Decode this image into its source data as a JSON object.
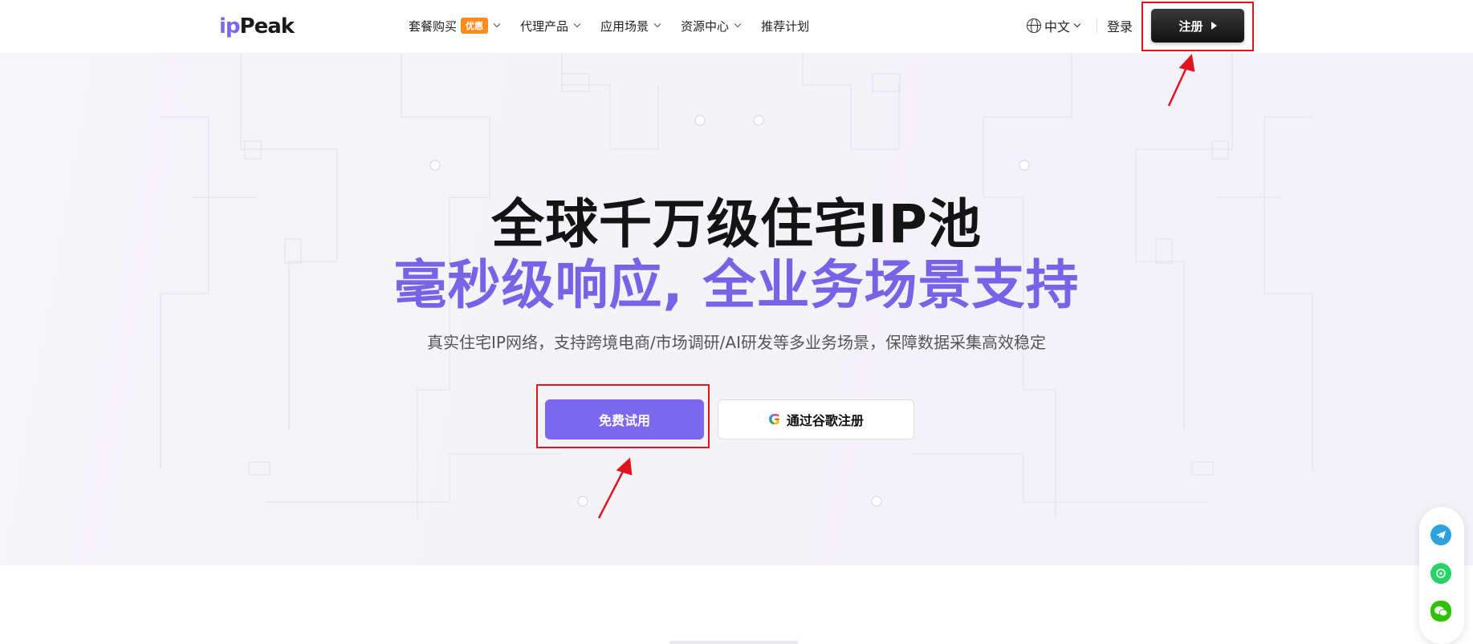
{
  "header": {
    "logo_ip": "ip",
    "logo_peak": "Peak",
    "nav": [
      {
        "label": "套餐购买",
        "badge": "优惠",
        "has_dropdown": true
      },
      {
        "label": "代理产品",
        "has_dropdown": true
      },
      {
        "label": "应用场景",
        "has_dropdown": true
      },
      {
        "label": "资源中心",
        "has_dropdown": true
      },
      {
        "label": "推荐计划",
        "has_dropdown": false
      }
    ],
    "language": "中文",
    "login": "登录",
    "register": "注册"
  },
  "hero": {
    "title_line1": "全球千万级住宅IP池",
    "title_line2": "毫秒级响应, 全业务场景支持",
    "subtitle": "真实住宅IP网络，支持跨境电商/市场调研/AI研发等多业务场景，保障数据采集高效稳定",
    "primary_cta": "免费试用",
    "google_cta": "通过谷歌注册",
    "google_icon": "G"
  },
  "floating_contact": [
    "telegram-icon",
    "whatsapp-icon",
    "wechat-icon"
  ],
  "colors": {
    "accent": "#7b68ee",
    "highlight_box": "#e0141e",
    "badge": "#ff8a1e"
  }
}
